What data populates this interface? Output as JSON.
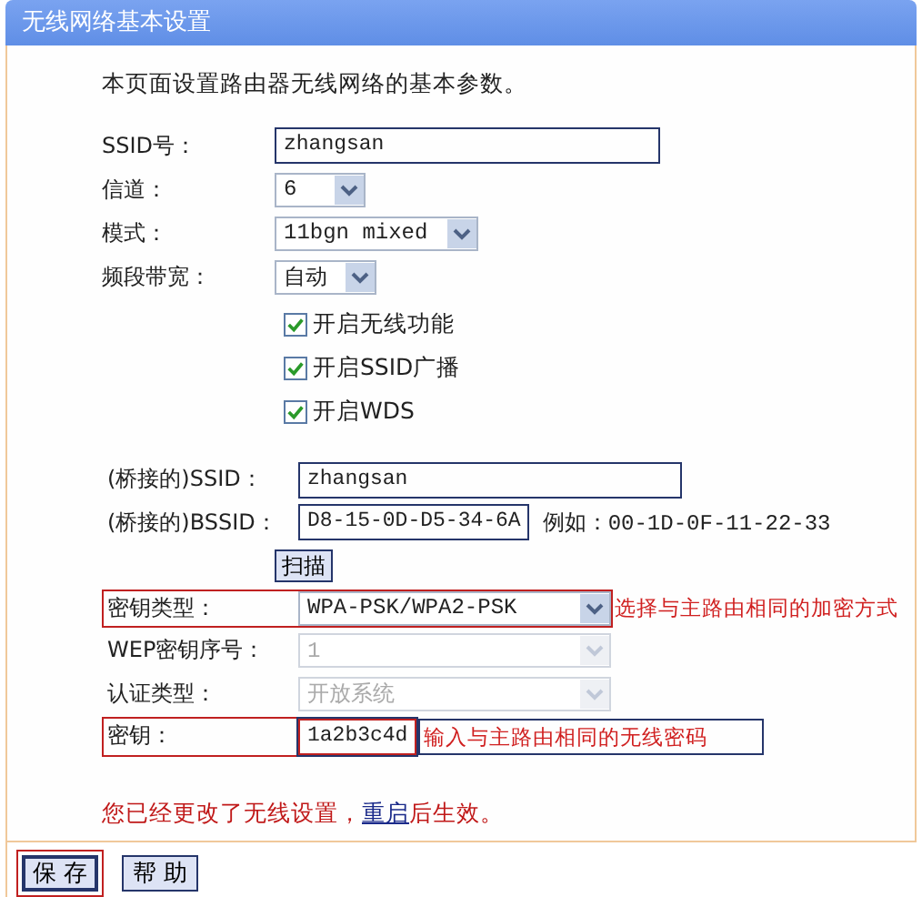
{
  "window": {
    "title": "无线网络基本设置"
  },
  "intro": "本页面设置路由器无线网络的基本参数。",
  "fields": [
    {
      "kind": "text",
      "label": "SSID号：",
      "value": "zhangsan"
    },
    {
      "kind": "select",
      "label": "信道：",
      "value": "6",
      "disabled": false
    },
    {
      "kind": "select",
      "label": "模式：",
      "value": "11bgn mixed",
      "disabled": false
    },
    {
      "kind": "select",
      "label": "频段带宽：",
      "value": "自动",
      "disabled": false
    }
  ],
  "checkboxes": [
    {
      "label": "开启无线功能",
      "checked": true
    },
    {
      "label": "开启SSID广播",
      "checked": true
    },
    {
      "label": "开启WDS",
      "checked": true
    }
  ],
  "bridge_fields": [
    {
      "kind": "text",
      "label": "(桥接的)SSID：",
      "value": "zhangsan",
      "highlighted": false
    },
    {
      "kind": "text",
      "label": "(桥接的)BSSID：",
      "value": "D8-15-0D-D5-34-6A",
      "hint": "例如：00-1D-0F-11-22-33",
      "highlighted": false
    },
    {
      "kind": "button",
      "label": "扫描"
    },
    {
      "kind": "select",
      "label": "密钥类型：",
      "value": "WPA-PSK/WPA2-PSK",
      "disabled": false,
      "highlighted": true,
      "note": "选择与主路由相同的加密方式",
      "note_boxed": false
    },
    {
      "kind": "select",
      "label": "WEP密钥序号：",
      "value": "1",
      "disabled": true,
      "highlighted": false
    },
    {
      "kind": "select",
      "label": "认证类型：",
      "value": "开放系统",
      "disabled": true,
      "highlighted": false
    },
    {
      "kind": "text",
      "label": "密钥：",
      "value": "1a2b3c4d",
      "highlighted": true,
      "note": "输入与主路由相同的无线密码",
      "note_boxed": true
    }
  ],
  "notice": {
    "before": "您已经更改了无线设置，",
    "link": "重启",
    "after": "后生效。"
  },
  "buttons": [
    {
      "label": "保 存",
      "focused": true
    },
    {
      "label": "帮 助",
      "focused": false
    }
  ]
}
